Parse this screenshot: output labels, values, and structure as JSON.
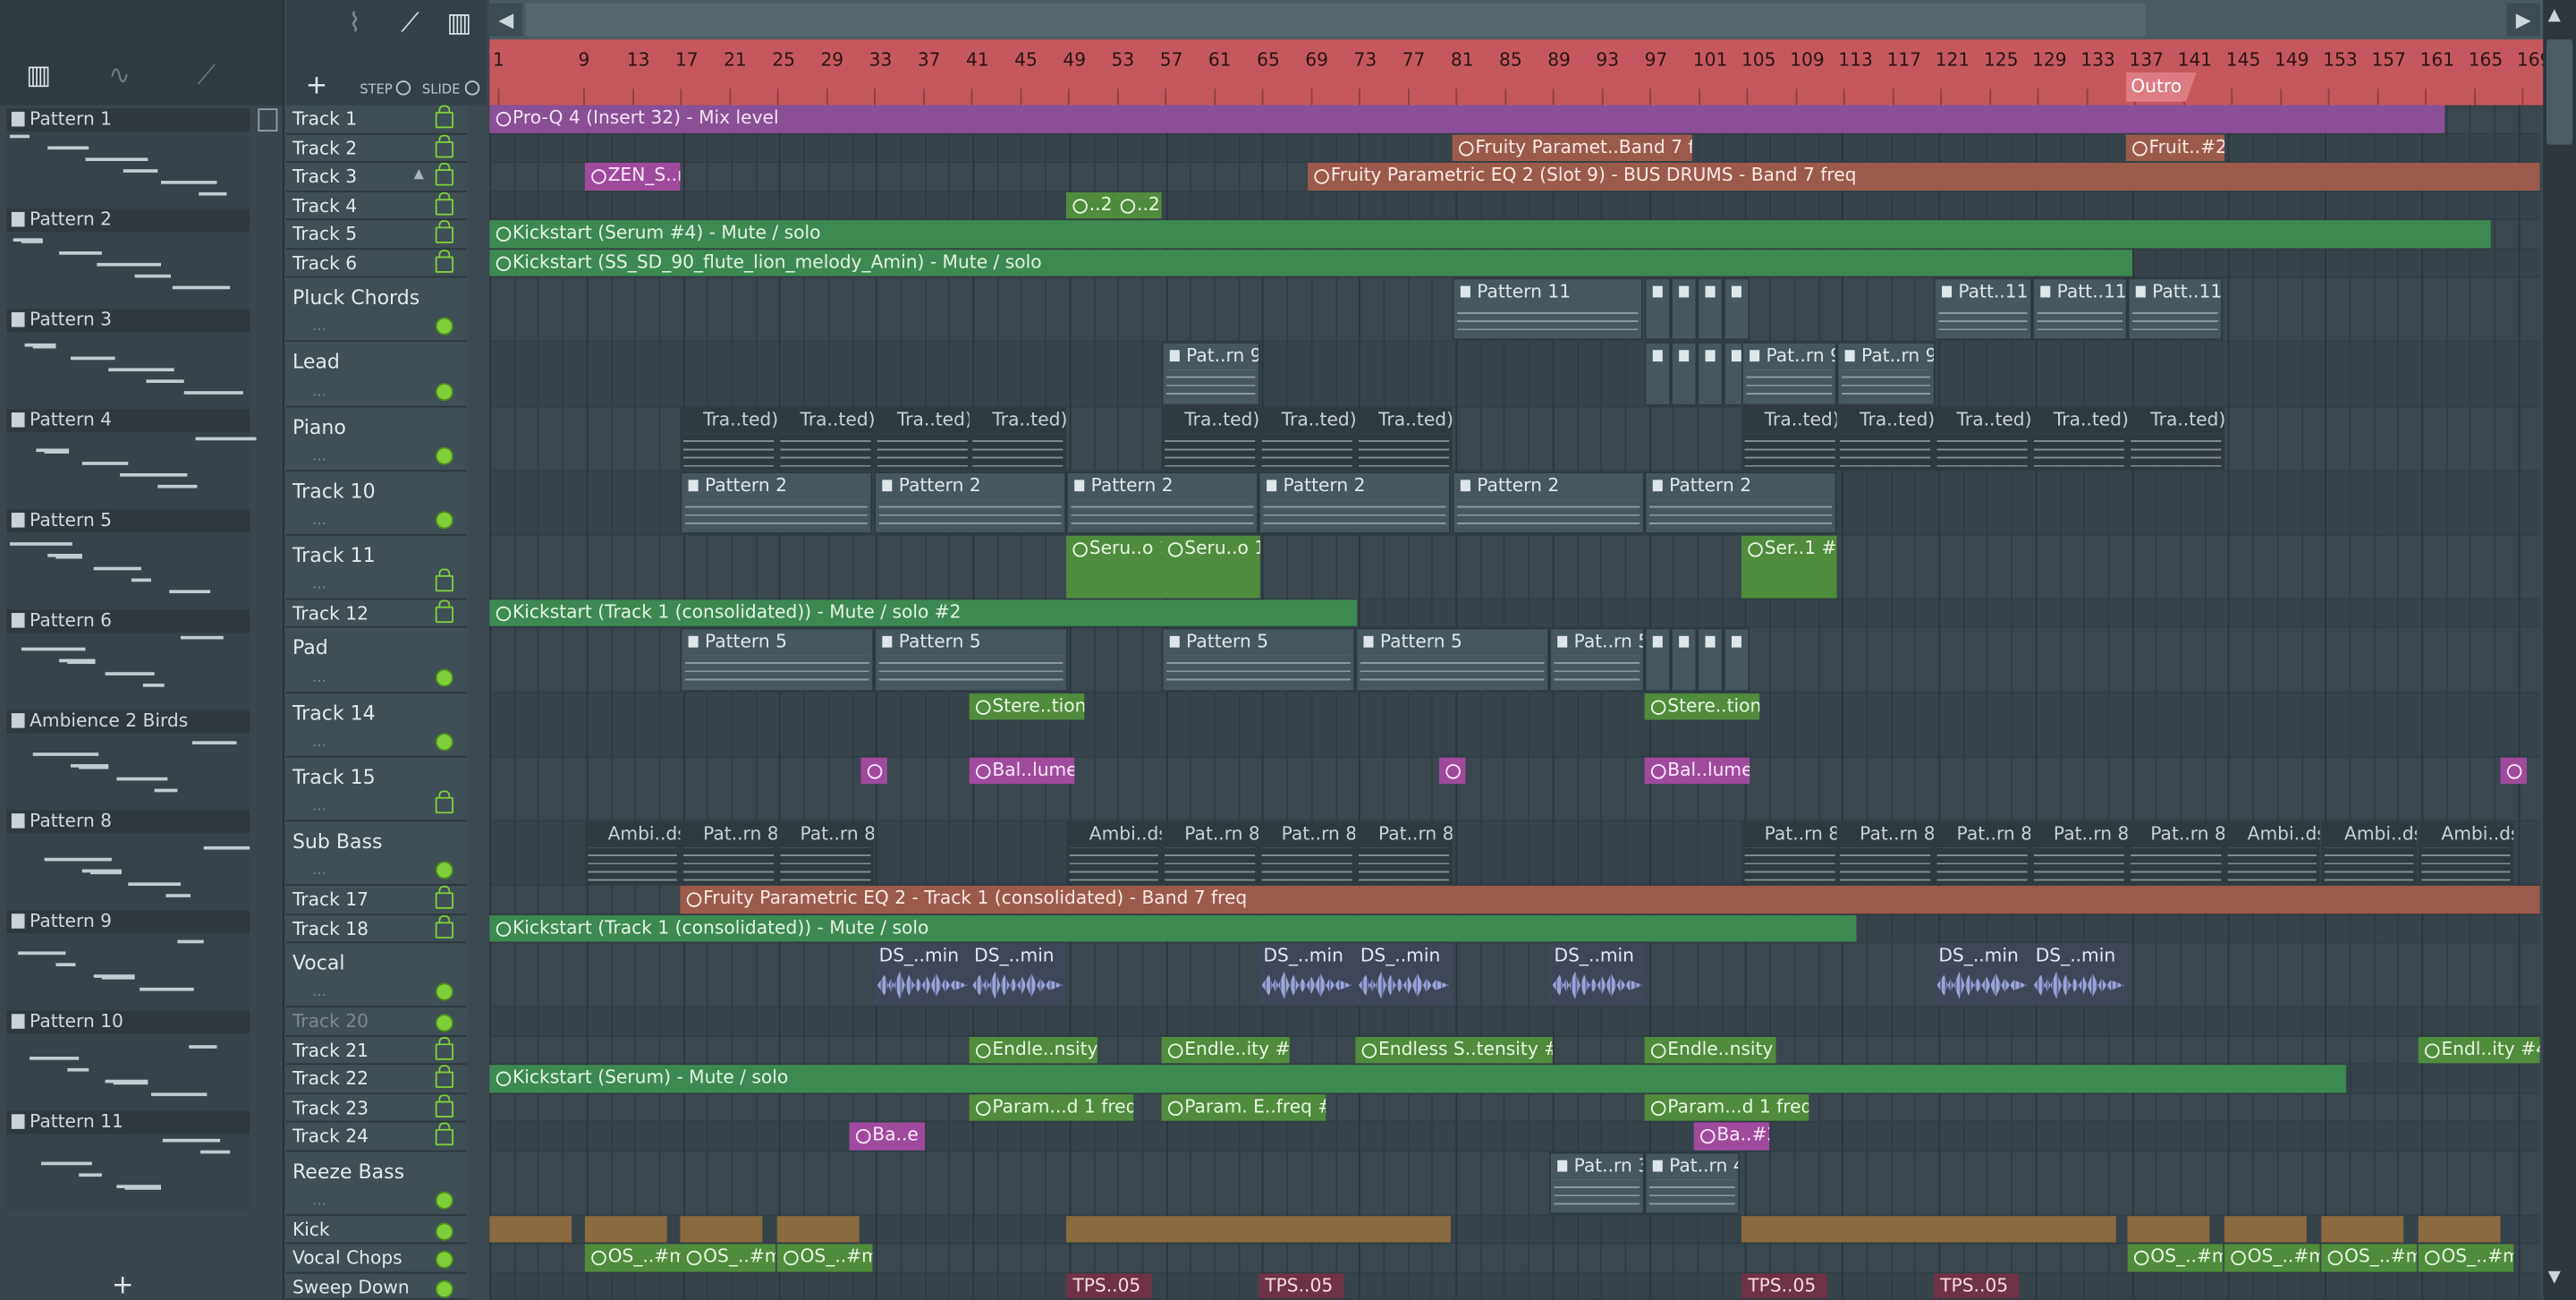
{
  "picker": {
    "patterns": [
      "Pattern 1",
      "Pattern 2",
      "Pattern 3",
      "Pattern 4",
      "Pattern 5",
      "Pattern 6",
      "Ambience 2 Birds",
      "Pattern 8",
      "Pattern 9",
      "Pattern 10",
      "Pattern 11"
    ],
    "add_label": "+"
  },
  "toolbar": {
    "step_label": "STEP",
    "slide_label": "SLIDE",
    "add_track_label": "+"
  },
  "ruler": {
    "bars": [
      "1",
      "9",
      "13",
      "17",
      "21",
      "25",
      "29",
      "33",
      "37",
      "41",
      "45",
      "49",
      "53",
      "57",
      "61",
      "65",
      "69",
      "73",
      "77",
      "81",
      "85",
      "89",
      "93",
      "97",
      "101",
      "105",
      "109",
      "113",
      "117",
      "121",
      "125",
      "129",
      "133",
      "137",
      "141",
      "145",
      "149",
      "153",
      "157",
      "161",
      "165",
      "169"
    ],
    "marker": "Outro"
  },
  "tracks": [
    {
      "name": "Track 1",
      "indicator": "lock"
    },
    {
      "name": "Track 2",
      "indicator": "lock"
    },
    {
      "name": "Track 3",
      "indicator": "lock"
    },
    {
      "name": "Track 4",
      "indicator": "lock"
    },
    {
      "name": "Track 5",
      "indicator": "lock"
    },
    {
      "name": "Track 6",
      "indicator": "lock"
    },
    {
      "name": "Pluck Chords",
      "indicator": "dot"
    },
    {
      "name": "Lead",
      "indicator": "dot"
    },
    {
      "name": "Piano",
      "indicator": "dot"
    },
    {
      "name": "Track 10",
      "indicator": "dot"
    },
    {
      "name": "Track 11",
      "indicator": "lock"
    },
    {
      "name": "Track 12",
      "indicator": "lock"
    },
    {
      "name": "Pad",
      "indicator": "dot"
    },
    {
      "name": "Track 14",
      "indicator": "dot"
    },
    {
      "name": "Track 15",
      "indicator": "lock"
    },
    {
      "name": "Sub Bass",
      "indicator": "dot"
    },
    {
      "name": "Track 17",
      "indicator": "lock"
    },
    {
      "name": "Track 18",
      "indicator": "lock"
    },
    {
      "name": "Vocal",
      "indicator": "dot"
    },
    {
      "name": "Track 20",
      "indicator": "dot"
    },
    {
      "name": "Track 21",
      "indicator": "lock"
    },
    {
      "name": "Track 22",
      "indicator": "lock"
    },
    {
      "name": "Track 23",
      "indicator": "lock"
    },
    {
      "name": "Track 24",
      "indicator": "lock"
    },
    {
      "name": "Reeze Bass",
      "indicator": "dot"
    },
    {
      "name": "Kick",
      "indicator": "dot"
    },
    {
      "name": "Vocal Chops",
      "indicator": "dot"
    },
    {
      "name": "Sweep Down",
      "indicator": "dot"
    }
  ],
  "clips": {
    "t1": "Pro-Q 4 (Insert 32) - Mix level",
    "t2a": "Fruity Paramet..Band 7 freq",
    "t2b": "Fruit..#2",
    "t3a": "ZEN_S..r",
    "t3b": "Fruity Parametric EQ 2 (Slot 9) - BUS DRUMS - Band 7 freq",
    "t4a": "..2",
    "t4b": "..2",
    "t5": "Kickstart (Serum #4) - Mute / solo",
    "t6": "Kickstart (SS_SD_90_flute_lion_melody_Amin) - Mute / solo",
    "pluck1": "Pattern 11",
    "pluck2": "Patt..11",
    "pluck3": "Patt..11",
    "pluck4": "Patt..11",
    "lead1": "Pat..rn 9",
    "lead2": "Pat..rn 9",
    "lead3": "Pat..rn 9",
    "piano": "Tra..ted)",
    "t10": "Pattern 2",
    "t11a": "Seru..o 1",
    "t11b": "Seru..o 1",
    "t11c": "Ser..1 #2",
    "t12": "Kickstart (Track 1 (consolidated)) - Mute / solo #2",
    "pad1": "Pattern 5",
    "pad5": "Pat..rn 5",
    "t14": "Stere..tion",
    "t15": "Bal..lume",
    "sub_ambi": "Ambi..ds",
    "sub_pat": "Pat..rn 8",
    "t17": "Fruity Parametric EQ 2 - Track 1 (consolidated) - Band 7 freq",
    "t18": "Kickstart (Track 1 (consolidated)) - Mute / solo",
    "vocal": "DS_..min",
    "t21a": "Endle..nsity",
    "t21b": "Endle..ity #2",
    "t21c": "Endless S..tensity #3",
    "t21d": "Endle..nsity",
    "t21e": "Endl..ity #4",
    "t22": "Kickstart (Serum) - Mute / solo",
    "t23a": "Param...d 1 freq",
    "t23b": "Param. E..freq #2",
    "t23c": "Param...d 1 freq",
    "t24a": "Ba..e",
    "t24b": "Ba..#2",
    "reeze1": "Pat..rn 3",
    "reeze2": "Pat..rn 4",
    "chops": "OS_..#m",
    "sweep": "TPS..05"
  }
}
